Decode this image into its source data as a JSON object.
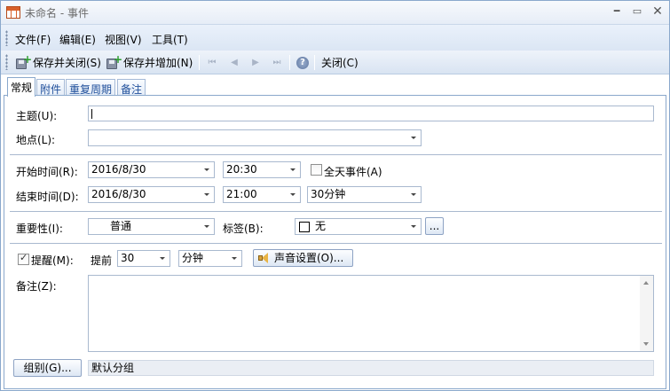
{
  "window": {
    "title": "未命名 - 事件"
  },
  "menu": {
    "items": [
      "文件(F)",
      "编辑(E)",
      "视图(V)",
      "工具(T)"
    ]
  },
  "toolbar": {
    "save_close": "保存并关闭(S)",
    "save_add": "保存并增加(N)",
    "close": "关闭(C)"
  },
  "tabs": [
    "常规",
    "附件",
    "重复周期",
    "备注"
  ],
  "form": {
    "subject": {
      "label": "主题(U):",
      "value": ""
    },
    "location": {
      "label": "地点(L):",
      "value": ""
    },
    "start": {
      "label": "开始时间(R):",
      "date": "2016/8/30",
      "time": "20:30"
    },
    "all_day": {
      "label": "全天事件(A)",
      "checked": false
    },
    "end": {
      "label": "结束时间(D):",
      "date": "2016/8/30",
      "time": "21:00",
      "duration": "30分钟"
    },
    "importance": {
      "label": "重要性(I):",
      "value": "普通"
    },
    "tag": {
      "label": "标签(B):",
      "value": "无",
      "more": "..."
    },
    "reminder": {
      "label": "提醒(M):",
      "checked": true,
      "advance_label": "提前",
      "amount": "30",
      "unit": "分钟",
      "sound_button": "声音设置(O)..."
    },
    "notes": {
      "label": "备注(Z):",
      "value": ""
    },
    "group": {
      "button": "组别(G)...",
      "value": "默认分组"
    }
  }
}
